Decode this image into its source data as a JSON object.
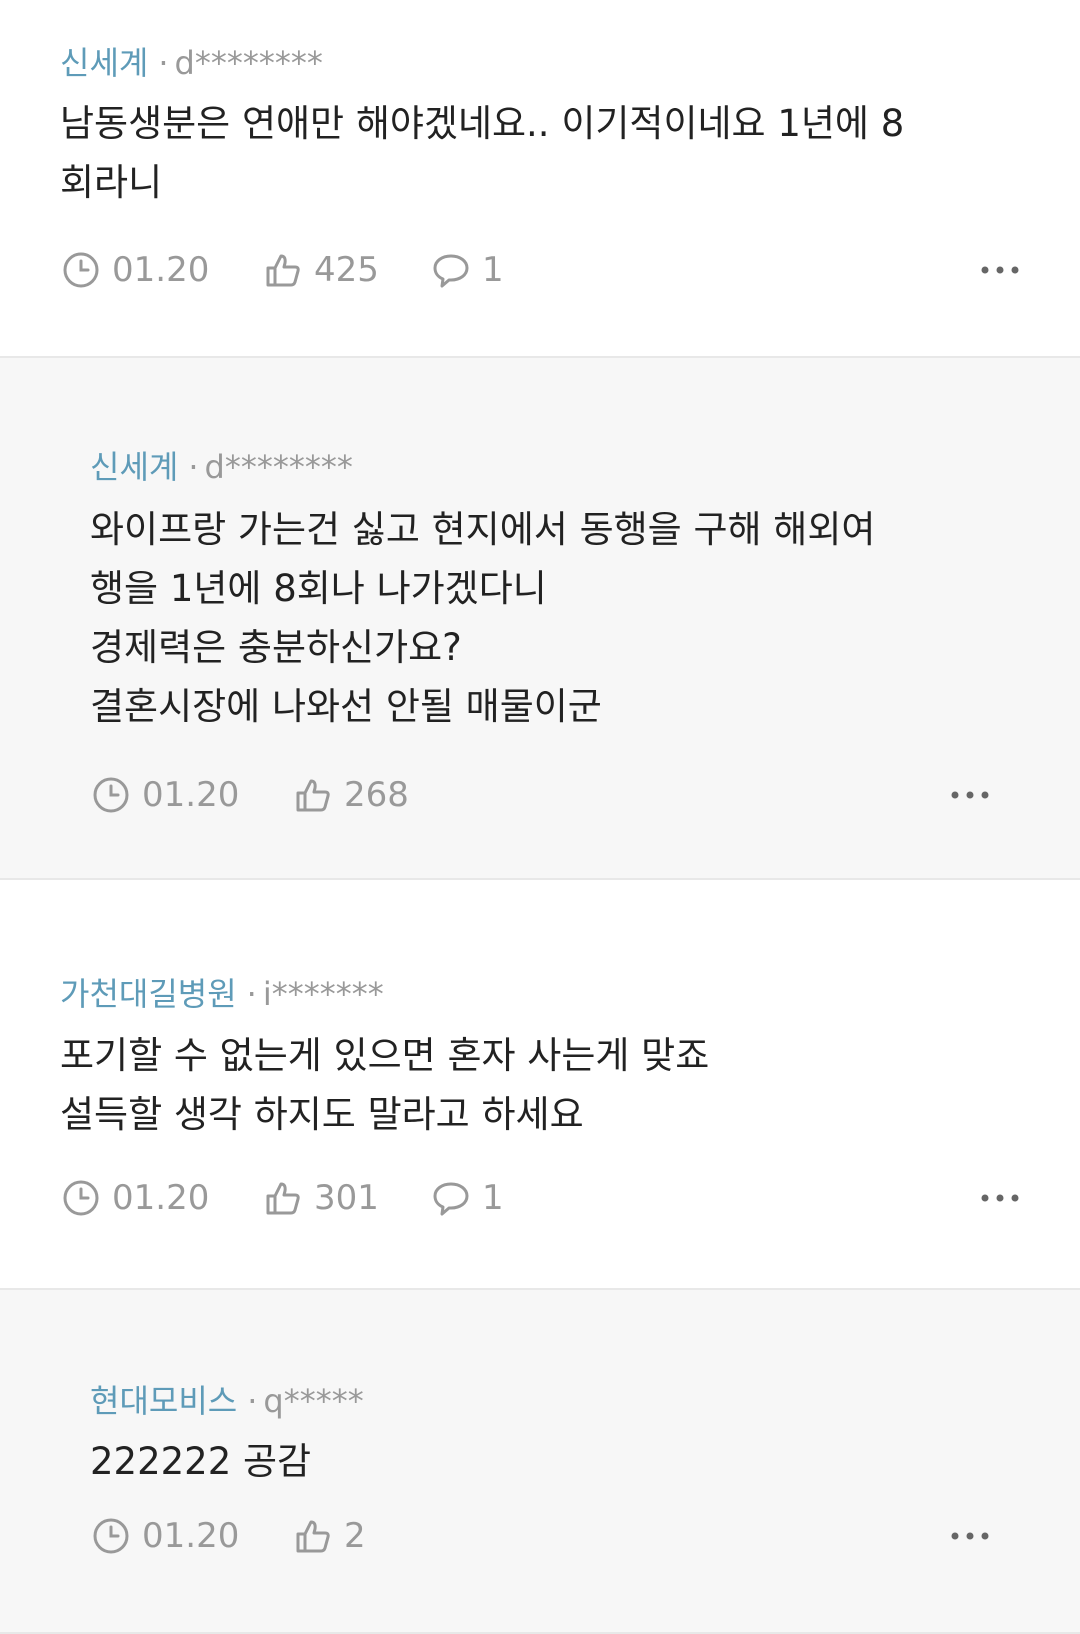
{
  "comments": [
    {
      "company": "신세계",
      "separator": "·",
      "user": "d********",
      "lines": [
        "남동생분은 연애만 해야겠네요.. 이기적이네요 1년에 8",
        "회라니"
      ],
      "date": "01.20",
      "likes": "425",
      "replies": "1"
    },
    {
      "company": "신세계",
      "separator": "·",
      "user": "d********",
      "lines": [
        "와이프랑 가는건 싫고 현지에서 동행을 구해 해외여",
        "행을 1년에 8회나 나가겠다니",
        "경제력은 충분하신가요?",
        "결혼시장에 나와선 안될 매물이군"
      ],
      "date": "01.20",
      "likes": "268"
    },
    {
      "company": "가천대길병원",
      "separator": "·",
      "user": "i*******",
      "lines": [
        "포기할 수 없는게 있으면 혼자 사는게 맞죠",
        "설득할 생각 하지도 말라고 하세요"
      ],
      "date": "01.20",
      "likes": "301",
      "replies": "1"
    },
    {
      "company": "현대모비스",
      "separator": "·",
      "user": "q*****",
      "lines": [
        "222222 공감"
      ],
      "date": "01.20",
      "likes": "2"
    }
  ],
  "icons": {
    "clock": "clock-icon",
    "like": "thumbs-up-icon",
    "reply": "speech-bubble-icon",
    "more": "more-dots-icon"
  },
  "colors": {
    "company": "#5e9bb8",
    "muted": "#999999",
    "text": "#222222",
    "reply_bg": "#f7f7f7"
  }
}
